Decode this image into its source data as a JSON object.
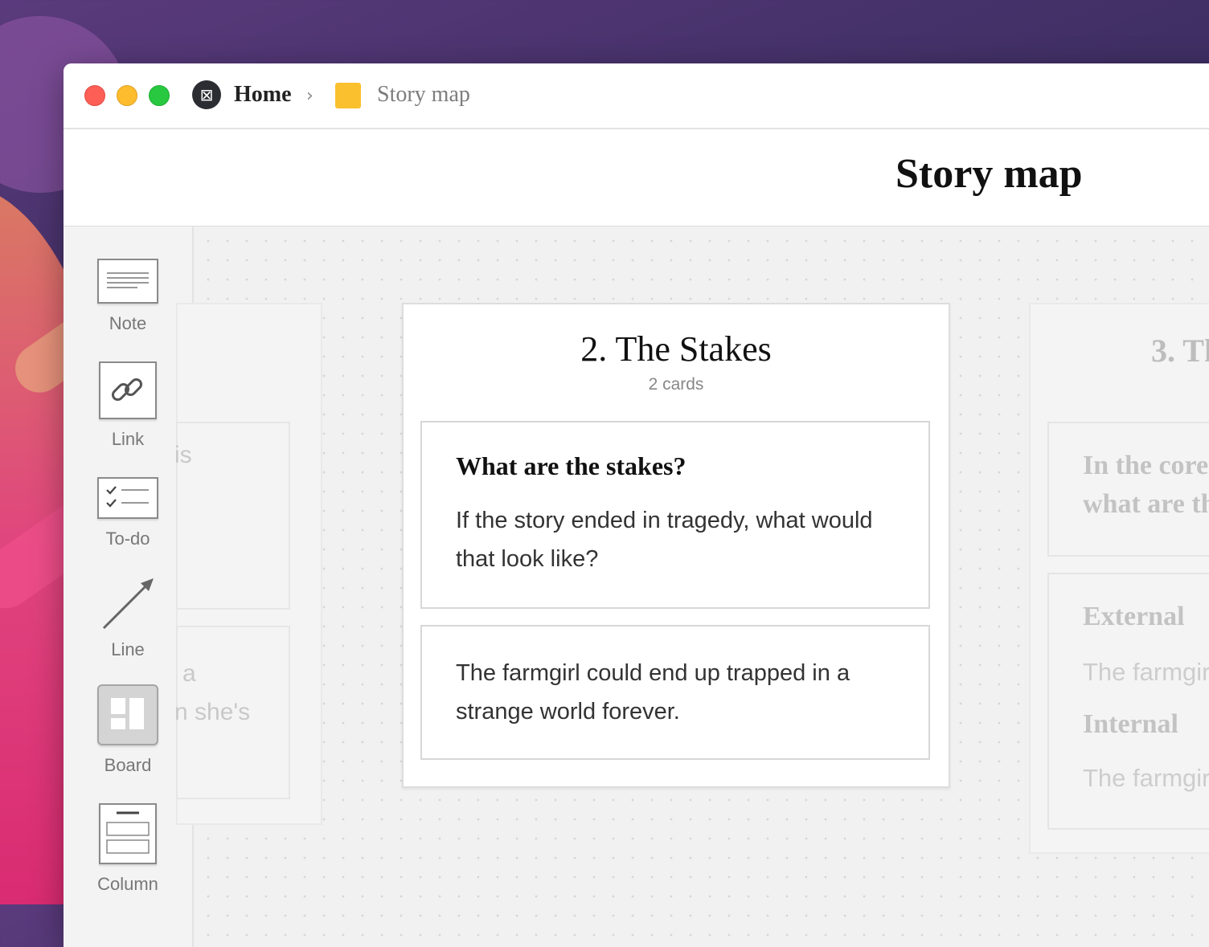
{
  "breadcrumb": {
    "home_label": "Home",
    "separator": "›",
    "board_label": "Story map",
    "board_color": "#fbc02d"
  },
  "page": {
    "title": "Story map"
  },
  "sidebar": {
    "tools": [
      {
        "label": "Note",
        "icon": "note-icon"
      },
      {
        "label": "Link",
        "icon": "link-icon"
      },
      {
        "label": "To-do",
        "icon": "todo-icon"
      },
      {
        "label": "Line",
        "icon": "arrow-line-icon"
      },
      {
        "label": "Board",
        "icon": "board-icon"
      },
      {
        "label": "Column",
        "icon": "column-icon"
      }
    ]
  },
  "left_column": {
    "fragments": [
      "is",
      "a",
      "n she's"
    ]
  },
  "main_column": {
    "title": "2. The Stakes",
    "count": "2 cards",
    "cards": [
      {
        "title": "What are the stakes?",
        "body": "If the story ended in tragedy, what would that look like?"
      },
      {
        "body": "The farmgirl could end up trapped in a strange world forever."
      }
    ]
  },
  "right_column": {
    "title": "3. Th",
    "card1_line1": "In the core",
    "card1_line2": "what are th",
    "external_heading": "External",
    "external_text": "The farmgir",
    "internal_heading": "Internal",
    "internal_text": "The farmgir"
  },
  "colors": {
    "close": "#fd5f57",
    "minimize": "#fdbc2e",
    "maximize": "#28c840"
  }
}
